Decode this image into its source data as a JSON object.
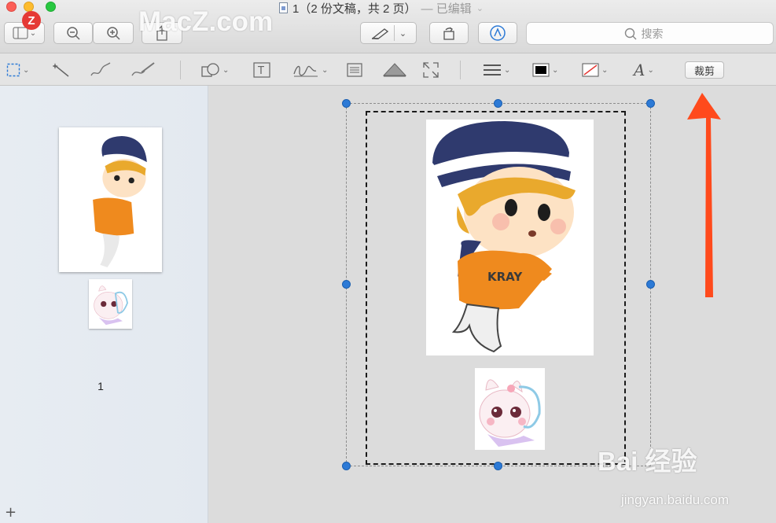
{
  "window": {
    "title": "1（2 份文稿，共 2 页）",
    "edited_status": "— 已编辑",
    "colors": {
      "close": "#fc5f57",
      "minimize": "#fdbc2e",
      "zoom": "#28c840"
    }
  },
  "toolbar": {
    "search_placeholder": "搜索"
  },
  "markup": {
    "crop_label": "裁剪",
    "border_color": "#000000",
    "fill_color": "none"
  },
  "sidebar": {
    "page_number": "1",
    "add_label": "+"
  },
  "watermarks": {
    "macz": "MacZ.com",
    "macz_badge": "Z",
    "baidu": "Bai 经验",
    "baidu_url": "jingyan.baidu.com"
  },
  "annotation": {
    "arrow_color": "#ff4a1c"
  }
}
